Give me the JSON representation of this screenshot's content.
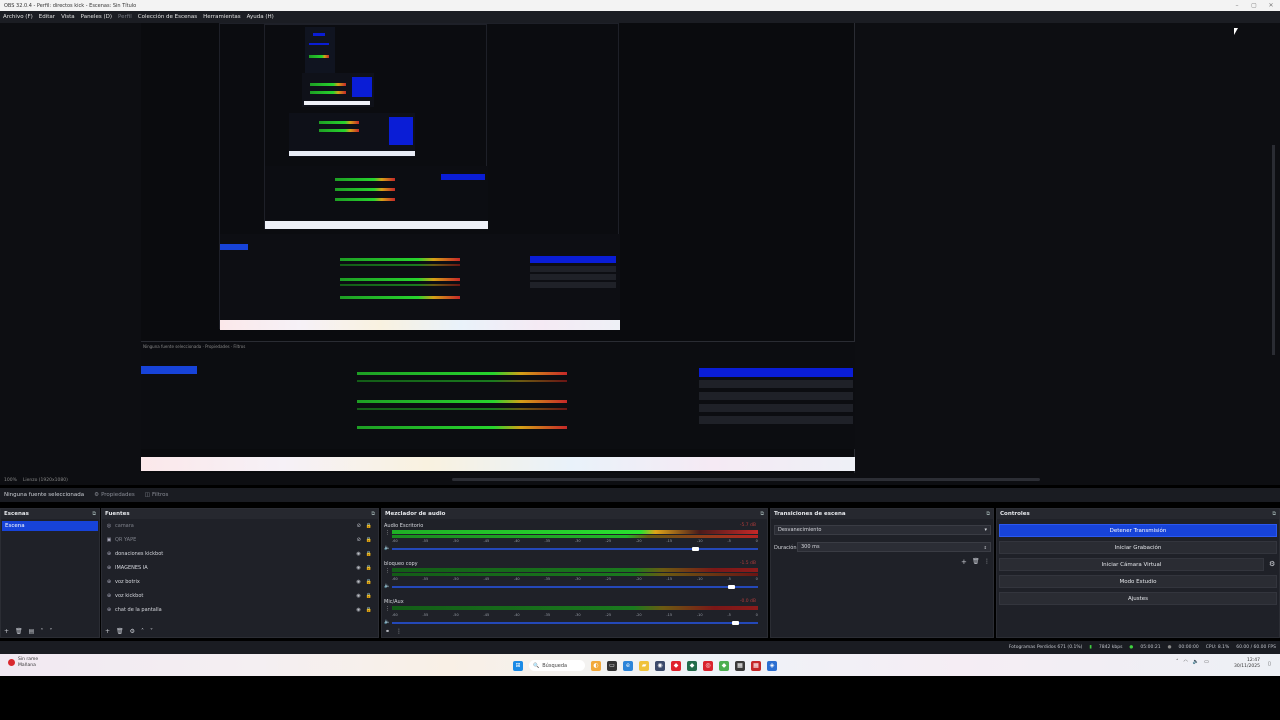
{
  "window": {
    "title": "OBS 32.0.4 - Perfil: directos kick - Escenas: Sin Título",
    "min": "–",
    "max": "▢",
    "close": "✕"
  },
  "menu": {
    "items": [
      "Archivo (F)",
      "Editar",
      "Vista",
      "Paneles (D)",
      "Perfil",
      "Colección de Escenas",
      "Herramientas",
      "Ayuda (H)"
    ]
  },
  "zoombar": {
    "zoom": "100%",
    "canvas_size": "Lienzo (1920x1080)"
  },
  "context": {
    "no_source": "Ninguna fuente seleccionada",
    "properties": "Propiedades",
    "filters": "Filtros"
  },
  "scenes": {
    "title": "Escenas",
    "items": [
      "Escena"
    ]
  },
  "sources": {
    "title": "Fuentes",
    "items": [
      {
        "name": "camara",
        "dim": true
      },
      {
        "name": "QR YAPE",
        "dim": true
      },
      {
        "name": "donaciones kickbot",
        "dim": false
      },
      {
        "name": "IMAGENES IA",
        "dim": false
      },
      {
        "name": "voz botrix",
        "dim": false
      },
      {
        "name": "voz kickbot",
        "dim": false
      },
      {
        "name": "chat de la pantalla",
        "dim": false
      }
    ]
  },
  "mixer": {
    "title": "Mezclador de audio",
    "tracks": [
      {
        "name": "Audio Escritorio",
        "db": "-5.7 dB"
      },
      {
        "name": "bloqueo copy",
        "db": "-1.5 dB"
      },
      {
        "name": "Mic/Aux",
        "db": "-0.0 dB"
      }
    ],
    "scale": [
      "-60",
      "-55",
      "-50",
      "-45",
      "-40",
      "-35",
      "-30",
      "-25",
      "-20",
      "-15",
      "-10",
      "-5",
      "0"
    ]
  },
  "transitions": {
    "title": "Transiciones de escena",
    "type": "Desvanecimiento",
    "duration_label": "Duración",
    "duration_value": "300 ms"
  },
  "controls": {
    "title": "Controles",
    "buttons": [
      "Detener Transmisión",
      "Iniciar Grabación",
      "Iniciar Cámara Virtual",
      "Modo Estudio",
      "Ajustes"
    ]
  },
  "status": {
    "dropped": "Fotogramas Perdidos 671 (0.1%)",
    "bitrate": "7842 kbps",
    "stream_time": "05:00:21",
    "rec_time": "00:00:00",
    "cpu": "CPU: 8.1%",
    "fps": "60.00 / 60.00 FPS"
  },
  "taskbar": {
    "weather_line1": "Sin rame",
    "weather_line2": "Mañana",
    "search": "Búsqueda",
    "time": "12:47",
    "date": "30/11/2025"
  },
  "colors": {
    "accent": "#1743d9",
    "meter_green": "#27d42d",
    "meter_red": "#c62828",
    "meter_yellow": "#d4a017"
  }
}
